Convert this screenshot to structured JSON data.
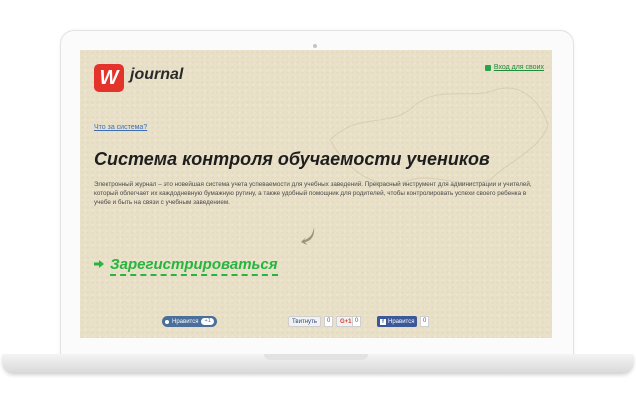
{
  "brand": {
    "logo_letter": "W",
    "name": "journal"
  },
  "header": {
    "login_label": "Вход для своих"
  },
  "intro": {
    "what_link": "Что за система?",
    "headline": "Система контроля обучаемости учеников",
    "description": "Электронный журнал – это новейшая система учета успеваемости для учебных заведений. Прекрасный инструмент для администрации и учителей, который облегчает их каждодневную бумажную рутину, а также удобный помощник для родителей, чтобы контролировать успехи своего ребенка в учебе и быть на связи с учебным заведением."
  },
  "register": {
    "label": "Зарегистрироваться"
  },
  "social": {
    "vk_label": "Нравится",
    "vk_count": "+1",
    "twitter_label": "Твитнуть",
    "twitter_count": "0",
    "gplus_label": "G+1",
    "gplus_count": "0",
    "fb_label": "Нравится",
    "fb_count": "0"
  },
  "colors": {
    "accent_green": "#27b53f",
    "logo_red": "#e4332a",
    "paper": "#e9e0c8"
  }
}
